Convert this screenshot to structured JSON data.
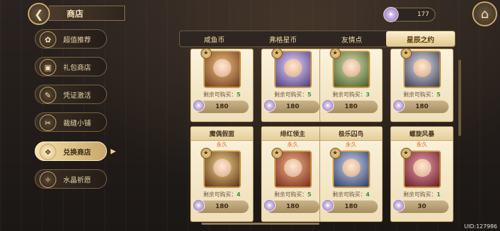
{
  "header": {
    "title": "商店",
    "back_icon": "❮",
    "home_icon": "⌂",
    "currency_amount": "177",
    "currency_icon": "✦"
  },
  "sidebar": {
    "items": [
      {
        "label": "超值推荐",
        "icon": "✿"
      },
      {
        "label": "礼包商店",
        "icon": "▣"
      },
      {
        "label": "凭证激活",
        "icon": "✎"
      },
      {
        "label": "裁缝小铺",
        "icon": "✂"
      },
      {
        "label": "兑换商店",
        "icon": "❖"
      },
      {
        "label": "水晶祈愿",
        "icon": "✧"
      }
    ],
    "active_index": 4
  },
  "tabs": [
    "咸鱼币",
    "弗格星币",
    "友情点",
    "星辰之约"
  ],
  "active_tab_index": 3,
  "grid": {
    "remain_label": "剩余可购买：",
    "top_row": [
      {
        "remain": "5",
        "price": "180"
      },
      {
        "remain": "5",
        "price": "180"
      },
      {
        "remain": "3",
        "price": "180"
      },
      {
        "remain": "5",
        "price": "180"
      }
    ],
    "bottom_row": [
      {
        "title": "魔偶假面",
        "duration": "永久",
        "remain": "4",
        "price": "180"
      },
      {
        "title": "绯红领主",
        "duration": "永久",
        "remain": "5",
        "price": "180"
      },
      {
        "title": "极乐囚鸟",
        "duration": "永久",
        "remain": "4",
        "price": "180"
      },
      {
        "title": "螺旋风暴",
        "duration": "永久",
        "remain": "1",
        "price": "30"
      }
    ]
  },
  "footer": {
    "uid": "UID:127986"
  },
  "colors": {
    "accent": "#c9a86a",
    "remain_value": "#3d8c2e",
    "duration": "#d96b2a"
  }
}
